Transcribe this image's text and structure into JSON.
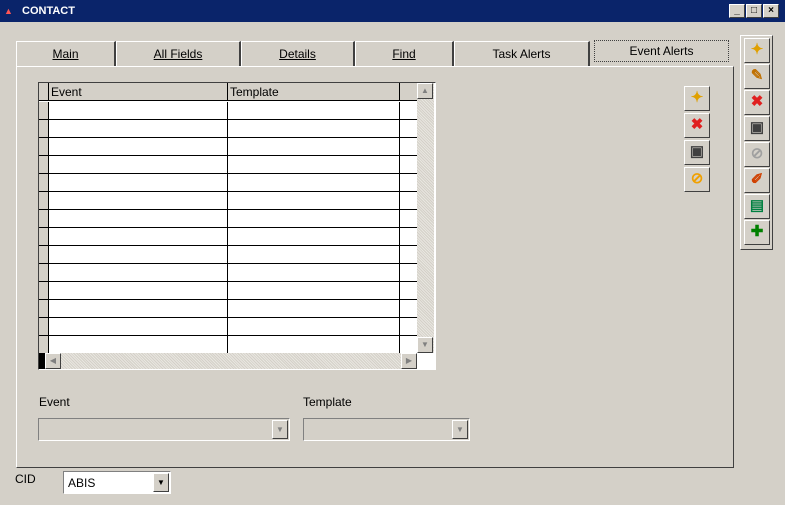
{
  "window": {
    "title": "CONTACT",
    "controls": {
      "minimize": "_",
      "maximize": "□",
      "close": "×"
    }
  },
  "tabs": [
    {
      "label": "Main",
      "active": false
    },
    {
      "label": "All Fields",
      "active": false
    },
    {
      "label": "Details",
      "active": false
    },
    {
      "label": "Find",
      "active": false
    },
    {
      "label": "Task Alerts",
      "active": false
    },
    {
      "label": "Event Alerts",
      "active": true
    }
  ],
  "grid": {
    "columns": [
      "Event",
      "Template"
    ],
    "rows": [
      [
        "",
        ""
      ],
      [
        "",
        ""
      ],
      [
        "",
        ""
      ],
      [
        "",
        ""
      ],
      [
        "",
        ""
      ],
      [
        "",
        ""
      ],
      [
        "",
        ""
      ],
      [
        "",
        ""
      ],
      [
        "",
        ""
      ],
      [
        "",
        ""
      ],
      [
        "",
        ""
      ],
      [
        "",
        ""
      ],
      [
        "",
        ""
      ],
      [
        "",
        ""
      ]
    ]
  },
  "grid_toolbar": [
    {
      "name": "new-record-icon",
      "glyph": "✦",
      "color": "#e0a000"
    },
    {
      "name": "delete-icon",
      "glyph": "✖",
      "color": "#e02020"
    },
    {
      "name": "save-icon",
      "glyph": "▣",
      "color": "#404040"
    },
    {
      "name": "cancel-icon",
      "glyph": "⊘",
      "color": "#f0a000"
    }
  ],
  "side_toolbar": [
    {
      "name": "new-record-icon",
      "glyph": "✦",
      "color": "#e0a000"
    },
    {
      "name": "edit-icon",
      "glyph": "✎",
      "color": "#c07000"
    },
    {
      "name": "delete-icon",
      "glyph": "✖",
      "color": "#e02020"
    },
    {
      "name": "save-icon",
      "glyph": "▣",
      "color": "#404040"
    },
    {
      "name": "cancel-icon",
      "glyph": "⊘",
      "color": "#a0a0a0"
    },
    {
      "name": "notes-icon",
      "glyph": "✐",
      "color": "#d04000"
    },
    {
      "name": "report-icon",
      "glyph": "▤",
      "color": "#008040"
    },
    {
      "name": "pin-icon",
      "glyph": "✚",
      "color": "#008000"
    }
  ],
  "form": {
    "event_label": "Event",
    "event_value": "",
    "template_label": "Template",
    "template_value": "",
    "cid_label": "CID",
    "cid_value": "ABIS"
  }
}
